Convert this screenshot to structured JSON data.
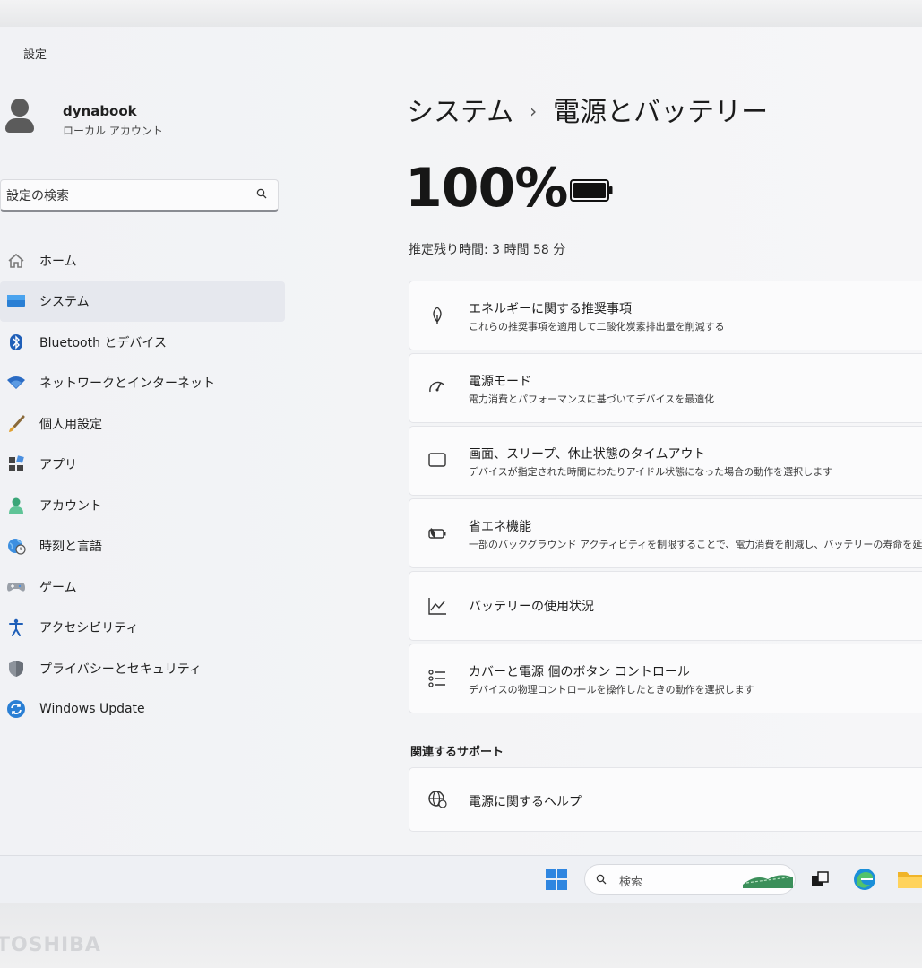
{
  "window": {
    "title": "設定",
    "back_glyph": "‹"
  },
  "user": {
    "name": "dynabook",
    "account_type": "ローカル アカウント"
  },
  "search": {
    "placeholder": "設定の検索"
  },
  "nav": [
    {
      "label": "ホーム",
      "icon": "home-icon"
    },
    {
      "label": "システム",
      "icon": "system-icon",
      "selected": true
    },
    {
      "label": "Bluetooth とデバイス",
      "icon": "bluetooth-icon"
    },
    {
      "label": "ネットワークとインターネット",
      "icon": "wifi-icon"
    },
    {
      "label": "個人用設定",
      "icon": "brush-icon"
    },
    {
      "label": "アプリ",
      "icon": "apps-icon"
    },
    {
      "label": "アカウント",
      "icon": "account-icon"
    },
    {
      "label": "時刻と言語",
      "icon": "globe-clock-icon"
    },
    {
      "label": "ゲーム",
      "icon": "gamepad-icon"
    },
    {
      "label": "アクセシビリティ",
      "icon": "accessibility-icon"
    },
    {
      "label": "プライバシーとセキュリティ",
      "icon": "shield-icon"
    },
    {
      "label": "Windows Update",
      "icon": "update-icon"
    }
  ],
  "breadcrumb": {
    "parent": "システム",
    "separator": "›",
    "current": "電源とバッテリー"
  },
  "battery": {
    "percent_text": "100%",
    "level": 1.0,
    "remaining": "推定残り時間: 3 時間 58 分"
  },
  "cards": [
    {
      "title": "エネルギーに関する推奨事項",
      "desc": "これらの推奨事項を適用して二酸化炭素排出量を削減する",
      "icon": "leaf-icon"
    },
    {
      "title": "電源モード",
      "desc": "電力消費とパフォーマンスに基づいてデバイスを最適化",
      "icon": "power-mode-icon"
    },
    {
      "title": "画面、スリープ、休止状態のタイムアウト",
      "desc": "デバイスが指定された時間にわたりアイドル状態になった場合の動作を選択します",
      "icon": "screen-timeout-icon"
    },
    {
      "title": "省エネ機能",
      "desc": "一部のバックグラウンド アクティビティを制限することで、電力消費を削減し、バッテリーの寿命を延ば",
      "icon": "energy-saver-icon"
    },
    {
      "title": "バッテリーの使用状況",
      "desc": "",
      "icon": "usage-chart-icon"
    },
    {
      "title": "カバーと電源 個のボタン コントロール",
      "desc": "デバイスの物理コントロールを操作したときの動作を選択します",
      "icon": "controls-list-icon"
    }
  ],
  "related": {
    "heading": "関連するサポート",
    "help_title": "電源に関するヘルプ"
  },
  "taskbar": {
    "search_label": "検索"
  },
  "brand": "TOSHIBA",
  "colors": {
    "accent": "#0067c0",
    "selected_bg": "#e6e8ee",
    "screen_bg": "#f3f4f6"
  }
}
